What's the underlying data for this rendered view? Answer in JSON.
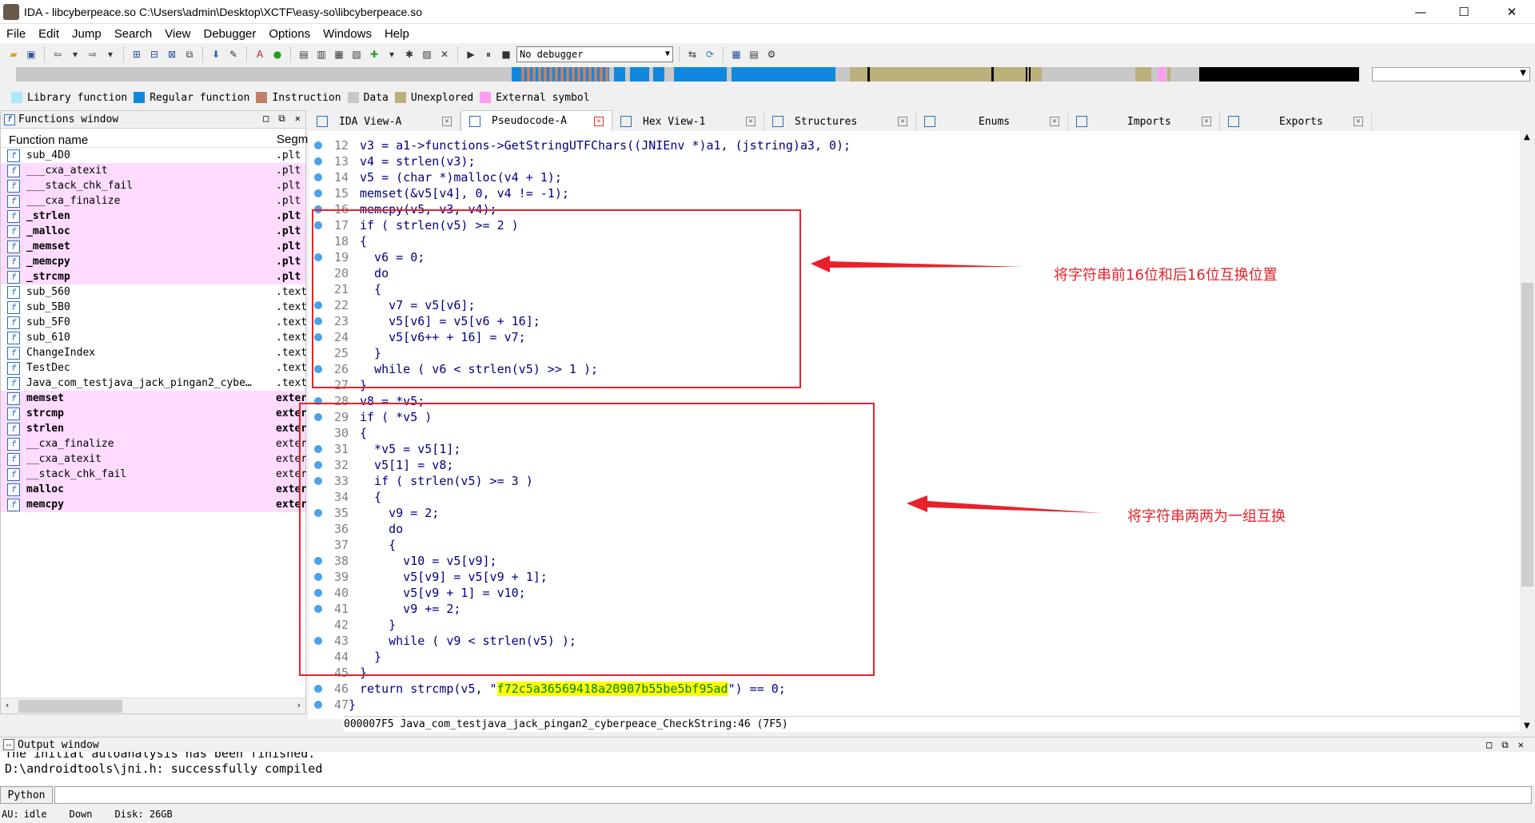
{
  "window": {
    "title": "IDA - libcyberpeace.so C:\\Users\\admin\\Desktop\\XCTF\\easy-so\\libcyberpeace.so",
    "min": "—",
    "max": "☐",
    "close": "✕"
  },
  "menu": [
    "File",
    "Edit",
    "Jump",
    "Search",
    "View",
    "Debugger",
    "Options",
    "Windows",
    "Help"
  ],
  "toolbar": {
    "debugger": "No debugger"
  },
  "legend": [
    {
      "label": "Library function",
      "color": "#aee8ff"
    },
    {
      "label": "Regular function",
      "color": "#1088e0"
    },
    {
      "label": "Instruction",
      "color": "#c0806a"
    },
    {
      "label": "Data",
      "color": "#c8c8c8"
    },
    {
      "label": "Unexplored",
      "color": "#bcb07a"
    },
    {
      "label": "External symbol",
      "color": "#ff9cf0"
    }
  ],
  "functions": {
    "title": "Functions window",
    "col_name": "Function name",
    "col_seg": "Segm",
    "rows": [
      {
        "name": "sub_4D0",
        "seg": ".plt",
        "pink": false,
        "bold": false
      },
      {
        "name": "___cxa_atexit",
        "seg": ".plt",
        "pink": true,
        "bold": false
      },
      {
        "name": "___stack_chk_fail",
        "seg": ".plt",
        "pink": true,
        "bold": false
      },
      {
        "name": "___cxa_finalize",
        "seg": ".plt",
        "pink": true,
        "bold": false
      },
      {
        "name": "_strlen",
        "seg": ".plt",
        "pink": true,
        "bold": true
      },
      {
        "name": "_malloc",
        "seg": ".plt",
        "pink": true,
        "bold": true
      },
      {
        "name": "_memset",
        "seg": ".plt",
        "pink": true,
        "bold": true
      },
      {
        "name": "_memcpy",
        "seg": ".plt",
        "pink": true,
        "bold": true
      },
      {
        "name": "_strcmp",
        "seg": ".plt",
        "pink": true,
        "bold": true
      },
      {
        "name": "sub_560",
        "seg": ".text",
        "pink": false,
        "bold": false
      },
      {
        "name": "sub_5B0",
        "seg": ".text",
        "pink": false,
        "bold": false
      },
      {
        "name": "sub_5F0",
        "seg": ".text",
        "pink": false,
        "bold": false
      },
      {
        "name": "sub_610",
        "seg": ".text",
        "pink": false,
        "bold": false
      },
      {
        "name": "ChangeIndex",
        "seg": ".text",
        "pink": false,
        "bold": false
      },
      {
        "name": "TestDec",
        "seg": ".text",
        "pink": false,
        "bold": false
      },
      {
        "name": "Java_com_testjava_jack_pingan2_cybe…",
        "seg": ".text",
        "pink": false,
        "bold": false
      },
      {
        "name": "memset",
        "seg": "exter",
        "pink": true,
        "bold": true
      },
      {
        "name": "strcmp",
        "seg": "exter",
        "pink": true,
        "bold": true
      },
      {
        "name": "strlen",
        "seg": "exter",
        "pink": true,
        "bold": true
      },
      {
        "name": "__cxa_finalize",
        "seg": "exter",
        "pink": true,
        "bold": false
      },
      {
        "name": "__cxa_atexit",
        "seg": "exter",
        "pink": true,
        "bold": false
      },
      {
        "name": "__stack_chk_fail",
        "seg": "exter",
        "pink": true,
        "bold": false
      },
      {
        "name": "malloc",
        "seg": "exter",
        "pink": true,
        "bold": true
      },
      {
        "name": "memcpy",
        "seg": "exter",
        "pink": true,
        "bold": true
      }
    ]
  },
  "tabs": [
    {
      "label": "IDA View-A",
      "active": false
    },
    {
      "label": "Pseudocode-A",
      "active": true
    },
    {
      "label": "Hex View-1",
      "active": false
    },
    {
      "label": "Structures",
      "active": false
    },
    {
      "label": "Enums",
      "active": false
    },
    {
      "label": "Imports",
      "active": false
    },
    {
      "label": "Exports",
      "active": false
    }
  ],
  "code": [
    {
      "n": "12",
      "dot": true,
      "t": "v3 = a1->functions->GetStringUTFChars((JNIEnv *)a1, (jstring)a3, 0);"
    },
    {
      "n": "13",
      "dot": true,
      "t": "v4 = strlen(v3);"
    },
    {
      "n": "14",
      "dot": true,
      "t": "v5 = (char *)malloc(v4 + 1);"
    },
    {
      "n": "15",
      "dot": true,
      "t": "memset(&v5[v4], 0, v4 != -1);"
    },
    {
      "n": "16",
      "dot": true,
      "t": "memcpy(v5, v3, v4);"
    },
    {
      "n": "17",
      "dot": true,
      "t": "if ( strlen(v5) >= 2 )"
    },
    {
      "n": "18",
      "dot": false,
      "t": "{"
    },
    {
      "n": "19",
      "dot": true,
      "t": "  v6 = 0;"
    },
    {
      "n": "20",
      "dot": false,
      "t": "  do"
    },
    {
      "n": "21",
      "dot": false,
      "t": "  {"
    },
    {
      "n": "22",
      "dot": true,
      "t": "    v7 = v5[v6];"
    },
    {
      "n": "23",
      "dot": true,
      "t": "    v5[v6] = v5[v6 + 16];"
    },
    {
      "n": "24",
      "dot": true,
      "t": "    v5[v6++ + 16] = v7;"
    },
    {
      "n": "25",
      "dot": false,
      "t": "  }"
    },
    {
      "n": "26",
      "dot": true,
      "t": "  while ( v6 < strlen(v5) >> 1 );"
    },
    {
      "n": "27",
      "dot": false,
      "t": "}"
    },
    {
      "n": "28",
      "dot": true,
      "t": "v8 = *v5;"
    },
    {
      "n": "29",
      "dot": true,
      "t": "if ( *v5 )"
    },
    {
      "n": "30",
      "dot": false,
      "t": "{"
    },
    {
      "n": "31",
      "dot": true,
      "t": "  *v5 = v5[1];"
    },
    {
      "n": "32",
      "dot": true,
      "t": "  v5[1] = v8;"
    },
    {
      "n": "33",
      "dot": true,
      "t": "  if ( strlen(v5) >= 3 )"
    },
    {
      "n": "34",
      "dot": false,
      "t": "  {"
    },
    {
      "n": "35",
      "dot": true,
      "t": "    v9 = 2;"
    },
    {
      "n": "36",
      "dot": false,
      "t": "    do"
    },
    {
      "n": "37",
      "dot": false,
      "t": "    {"
    },
    {
      "n": "38",
      "dot": true,
      "t": "      v10 = v5[v9];"
    },
    {
      "n": "39",
      "dot": true,
      "t": "      v5[v9] = v5[v9 + 1];"
    },
    {
      "n": "40",
      "dot": true,
      "t": "      v5[v9 + 1] = v10;"
    },
    {
      "n": "41",
      "dot": true,
      "t": "      v9 += 2;"
    },
    {
      "n": "42",
      "dot": false,
      "t": "    }"
    },
    {
      "n": "43",
      "dot": true,
      "t": "    while ( v9 < strlen(v5) );"
    },
    {
      "n": "44",
      "dot": false,
      "t": "  }"
    },
    {
      "n": "45",
      "dot": false,
      "t": "}"
    }
  ],
  "ret_line": {
    "n": "46",
    "pre": "return strcmp(v5, \"",
    "str": "f72c5a36569418a20907b55be5bf95ad",
    "post": "\") == 0;"
  },
  "end_line": {
    "n": "47",
    "t": "}"
  },
  "annotations": {
    "swap16": "将字符串前16位和后16位互换位置",
    "swap2": "将字符串两两为一组互换"
  },
  "code_status": "000007F5 Java_com_testjava_jack_pingan2_cyberpeace_CheckString:46 (7F5)",
  "output": {
    "title": "Output window",
    "lines": [
      "The initial autoanalysis has been finished.",
      "D:\\androidtools\\jni.h: successfully compiled"
    ],
    "python": "Python"
  },
  "status": {
    "au": "AU:",
    "state": "idle",
    "dir": "Down",
    "disk": "Disk: 26GB"
  }
}
